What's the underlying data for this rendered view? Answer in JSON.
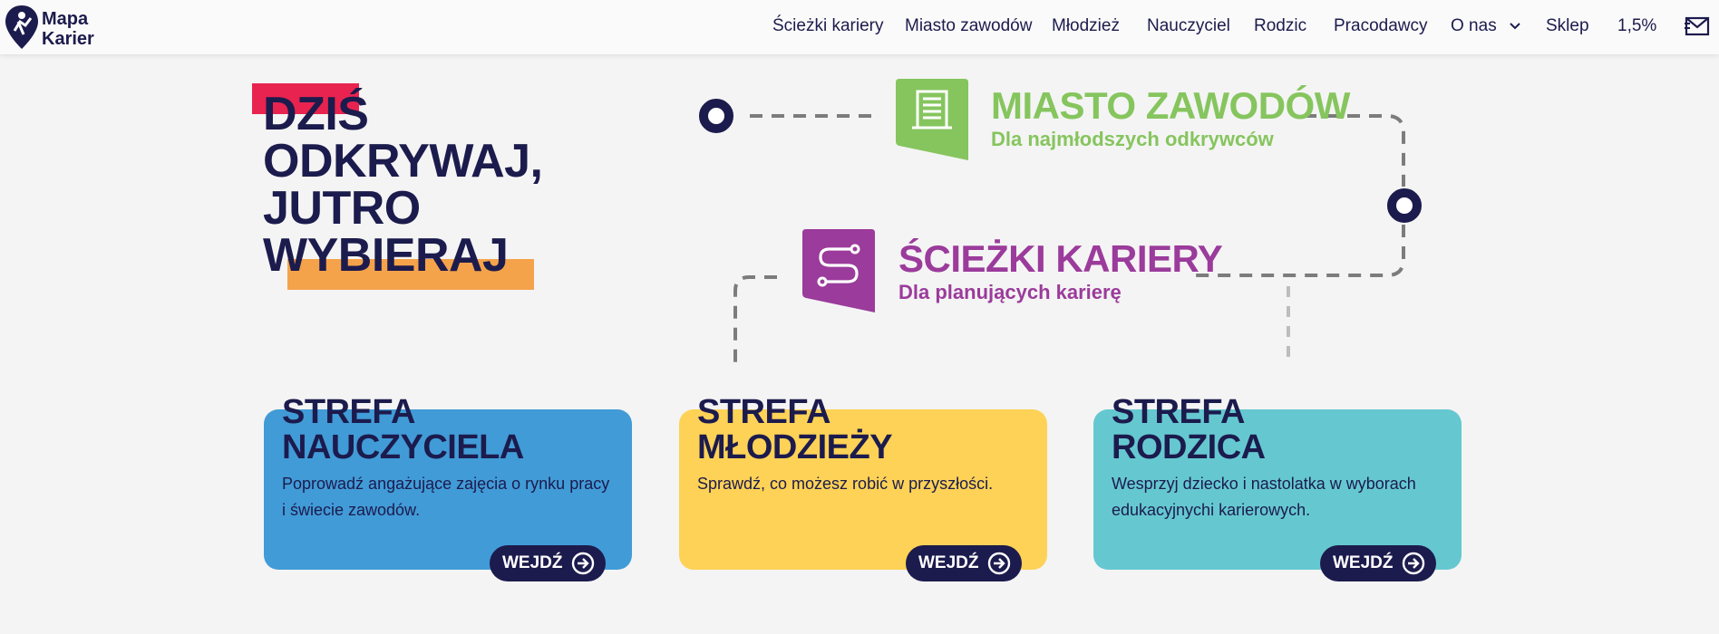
{
  "header": {
    "logo": {
      "line1": "Mapa",
      "line2": "Karier"
    },
    "nav": [
      "Ścieżki kariery",
      "Miasto zawodów",
      "Młodzież",
      "Nauczyciel",
      "Rodzic",
      "Pracodawcy",
      "O nas",
      "Sklep",
      "1,5%"
    ],
    "mail_icon": "envelope-icon"
  },
  "hero": {
    "line1": "DZIŚ",
    "line2": "ODKRYWAJ,",
    "line3": "JUTRO",
    "line4": "WYBIERAJ"
  },
  "sections": [
    {
      "title": "MIASTO ZAWODÓW",
      "subtitle": "Dla najmłodszych odkrywców",
      "color": "#86c55e",
      "icon": "building-icon"
    },
    {
      "title": "ŚCIEŻKI KARIERY",
      "subtitle": "Dla planujących karierę",
      "color": "#9b3b9b",
      "icon": "path-icon"
    }
  ],
  "cards": [
    {
      "title1": "STREFA",
      "title2": "NAUCZYCIELA",
      "desc1": "Poprowadź angażujące zajęcia o rynku pracy",
      "desc2": "i świecie zawodów.",
      "button": "WEJDŹ",
      "color": "#419bd7"
    },
    {
      "title1": "STREFA",
      "title2": "MŁODZIEŻY",
      "desc1": "Sprawdź, co możesz robić w przyszłości.",
      "desc2": "",
      "button": "WEJDŹ",
      "color": "#fdd256"
    },
    {
      "title1": "STREFA",
      "title2": "RODZICA",
      "desc1": "Wesprzyj dziecko i nastolatka w wyborach",
      "desc2": "edukacyjnychi karierowych.",
      "button": "WEJDŹ",
      "color": "#65c8d0"
    }
  ],
  "colors": {
    "navy": "#1c1b4d",
    "red": "#e8234f",
    "orange": "#f5a34a",
    "green": "#86c55e",
    "purple": "#9b3b9b"
  }
}
